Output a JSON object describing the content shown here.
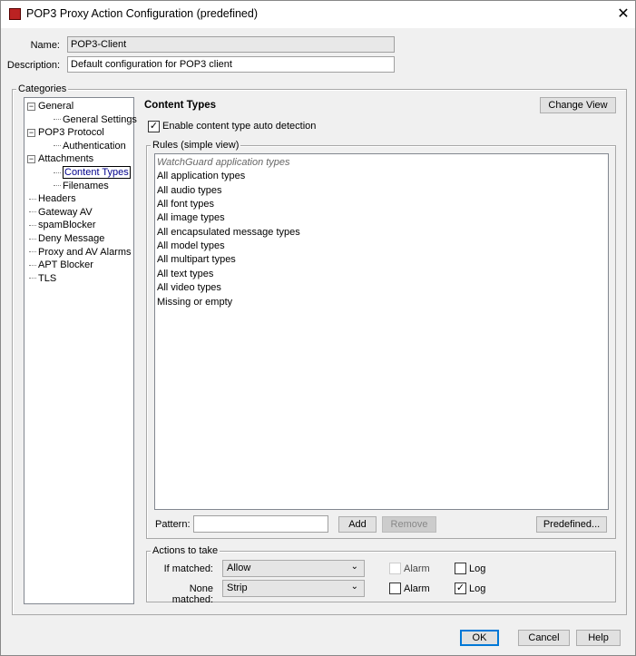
{
  "window": {
    "title": "POP3 Proxy Action Configuration (predefined)",
    "close": "✕"
  },
  "form": {
    "name_label": "Name:",
    "name_value": "POP3-Client",
    "description_label": "Description:",
    "description_value": "Default configuration for POP3 client"
  },
  "categories": {
    "title": "Categories",
    "tree": [
      {
        "label": "General",
        "level": 0,
        "expander": "−"
      },
      {
        "label": "General Settings",
        "level": 1
      },
      {
        "label": "POP3 Protocol",
        "level": 0,
        "expander": "−"
      },
      {
        "label": "Authentication",
        "level": 1
      },
      {
        "label": "Attachments",
        "level": 0,
        "expander": "−"
      },
      {
        "label": "Content Types",
        "level": 1,
        "selected": true
      },
      {
        "label": "Filenames",
        "level": 1
      },
      {
        "label": "Headers",
        "level": 0
      },
      {
        "label": "Gateway AV",
        "level": 0
      },
      {
        "label": "spamBlocker",
        "level": 0
      },
      {
        "label": "Deny Message",
        "level": 0
      },
      {
        "label": "Proxy and AV Alarms",
        "level": 0
      },
      {
        "label": "APT Blocker",
        "level": 0
      },
      {
        "label": "TLS",
        "level": 0
      }
    ]
  },
  "content": {
    "heading": "Content Types",
    "change_view": "Change View",
    "auto_detect_label": "Enable content type auto detection",
    "auto_detect_checked": true,
    "rules_title": "Rules (simple view)",
    "rules": [
      "WatchGuard application types",
      "All application types",
      "All audio types",
      "All font types",
      "All image types",
      "All encapsulated message types",
      "All model types",
      "All multipart types",
      "All text types",
      "All video types",
      "Missing or empty"
    ],
    "pattern_label": "Pattern:",
    "pattern_value": "",
    "add": "Add",
    "remove": "Remove",
    "predefined": "Predefined..."
  },
  "actions": {
    "title": "Actions to take",
    "if_matched_label": "If matched:",
    "if_matched_value": "Allow",
    "if_alarm": "Alarm",
    "if_alarm_checked": false,
    "if_log": "Log",
    "if_log_checked": false,
    "none_matched_label": "None matched:",
    "none_matched_value": "Strip",
    "none_alarm": "Alarm",
    "none_alarm_checked": false,
    "none_log": "Log",
    "none_log_checked": true,
    "chevron": "⌄"
  },
  "footer": {
    "ok": "OK",
    "cancel": "Cancel",
    "help": "Help"
  }
}
